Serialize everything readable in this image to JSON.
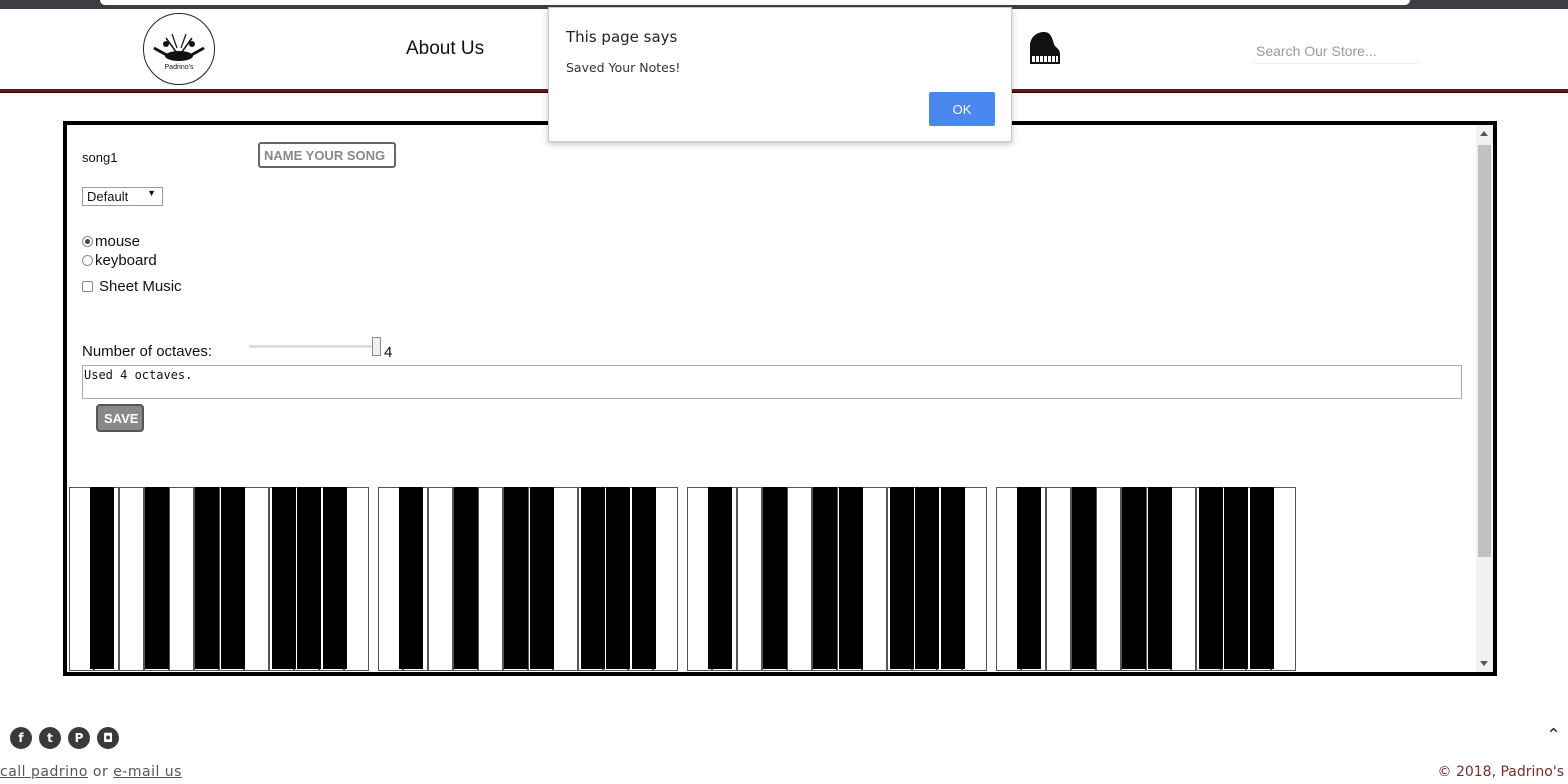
{
  "header": {
    "logo_text": "Padrino's",
    "nav_about": "About Us",
    "search_placeholder": "Search Our Store..."
  },
  "dialog": {
    "title": "This page says",
    "message": "Saved Your Notes!",
    "ok_label": "OK"
  },
  "editor": {
    "song_name": "song1",
    "name_placeholder": "NAME YOUR SONG",
    "instrument_selected": "Default",
    "input_modes": [
      {
        "label": "mouse",
        "selected": true
      },
      {
        "label": "keyboard",
        "selected": false
      }
    ],
    "sheet_music_label": "Sheet Music",
    "sheet_music_checked": false,
    "octaves_label": "Number of octaves:",
    "octaves_value": "4",
    "notes_text": "Used 4 octaves.",
    "save_label": "SAVE"
  },
  "piano": {
    "octaves": 4,
    "white_keys_per_octave": 12,
    "black_keys_per_octave": 7
  },
  "footer": {
    "social_icons": [
      "facebook-icon",
      "twitter-icon",
      "pinterest-icon",
      "instagram-icon"
    ],
    "contact_call": "call padrino",
    "contact_or": "or",
    "contact_email": "e-mail us",
    "copyright": "© 2018, Padrino's"
  },
  "colors": {
    "header_border": "#6b1414",
    "dialog_button": "#4a87ee",
    "copyright": "#7a2b2b"
  }
}
